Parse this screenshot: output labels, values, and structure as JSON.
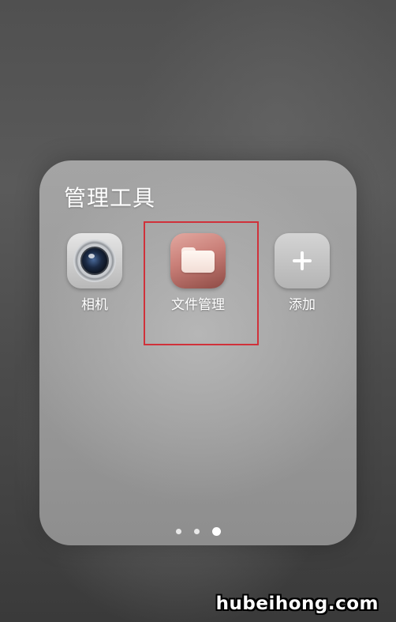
{
  "folder": {
    "title": "管理工具",
    "apps": [
      {
        "label": "相机",
        "icon": "camera-icon"
      },
      {
        "label": "文件管理",
        "icon": "file-manager-icon"
      },
      {
        "label": "添加",
        "icon": "add-icon"
      }
    ],
    "pager": {
      "count": 3,
      "active_index": 3
    }
  },
  "highlight_color": "#d0313a",
  "watermark": "hubeihong.com"
}
